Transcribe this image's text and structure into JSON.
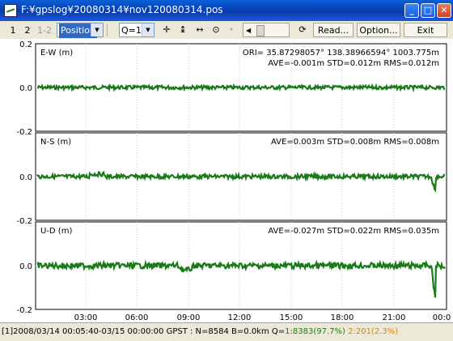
{
  "window": {
    "title": "F:¥gpslog¥20080314¥nov120080314.pos",
    "minimize_icon": "minimize-icon",
    "maximize_icon": "maximize-icon",
    "close_icon": "close-icon"
  },
  "toolbar": {
    "btn1": "1",
    "btn2": "2",
    "btn12": "1-2",
    "plot_type": "Position",
    "quality": "Q=1",
    "read_label": "Read...",
    "option_label": "Option...",
    "exit_label": "Exit",
    "icons": [
      "crosshair-icon",
      "vertical-fit-icon",
      "horizontal-fit-icon",
      "center-origin-icon",
      "dot-icon",
      "reload-icon"
    ]
  },
  "plots": {
    "panels": [
      {
        "label": "E-W (m)",
        "stats": "AVE=-0.001m STD=0.012m RMS=0.012m",
        "ori": "ORI= 35.87298057°  138.38966594°  1003.775m"
      },
      {
        "label": "N-S (m)",
        "stats": "AVE=0.003m STD=0.008m RMS=0.008m"
      },
      {
        "label": "U-D (m)",
        "stats": "AVE=-0.027m STD=0.022m RMS=0.035m"
      }
    ],
    "y_ticks": [
      "0.2",
      "0.0",
      "-0.2"
    ],
    "x_ticks": [
      "03:00",
      "06:00",
      "09:00",
      "12:00",
      "15:00",
      "18:00",
      "21:00",
      "00:0"
    ],
    "line_color": "#1a7a1a"
  },
  "status": {
    "prefix": "[1]2008/03/14 00:05:40-03/15 00:00:00 GPST : N=8584 B=0.0km Q=",
    "q1": "1:8383(97.7%)",
    "q2": "2:201(2.3%)",
    "q1_color": "#0a8a0a",
    "q2_color": "#e08000"
  }
}
